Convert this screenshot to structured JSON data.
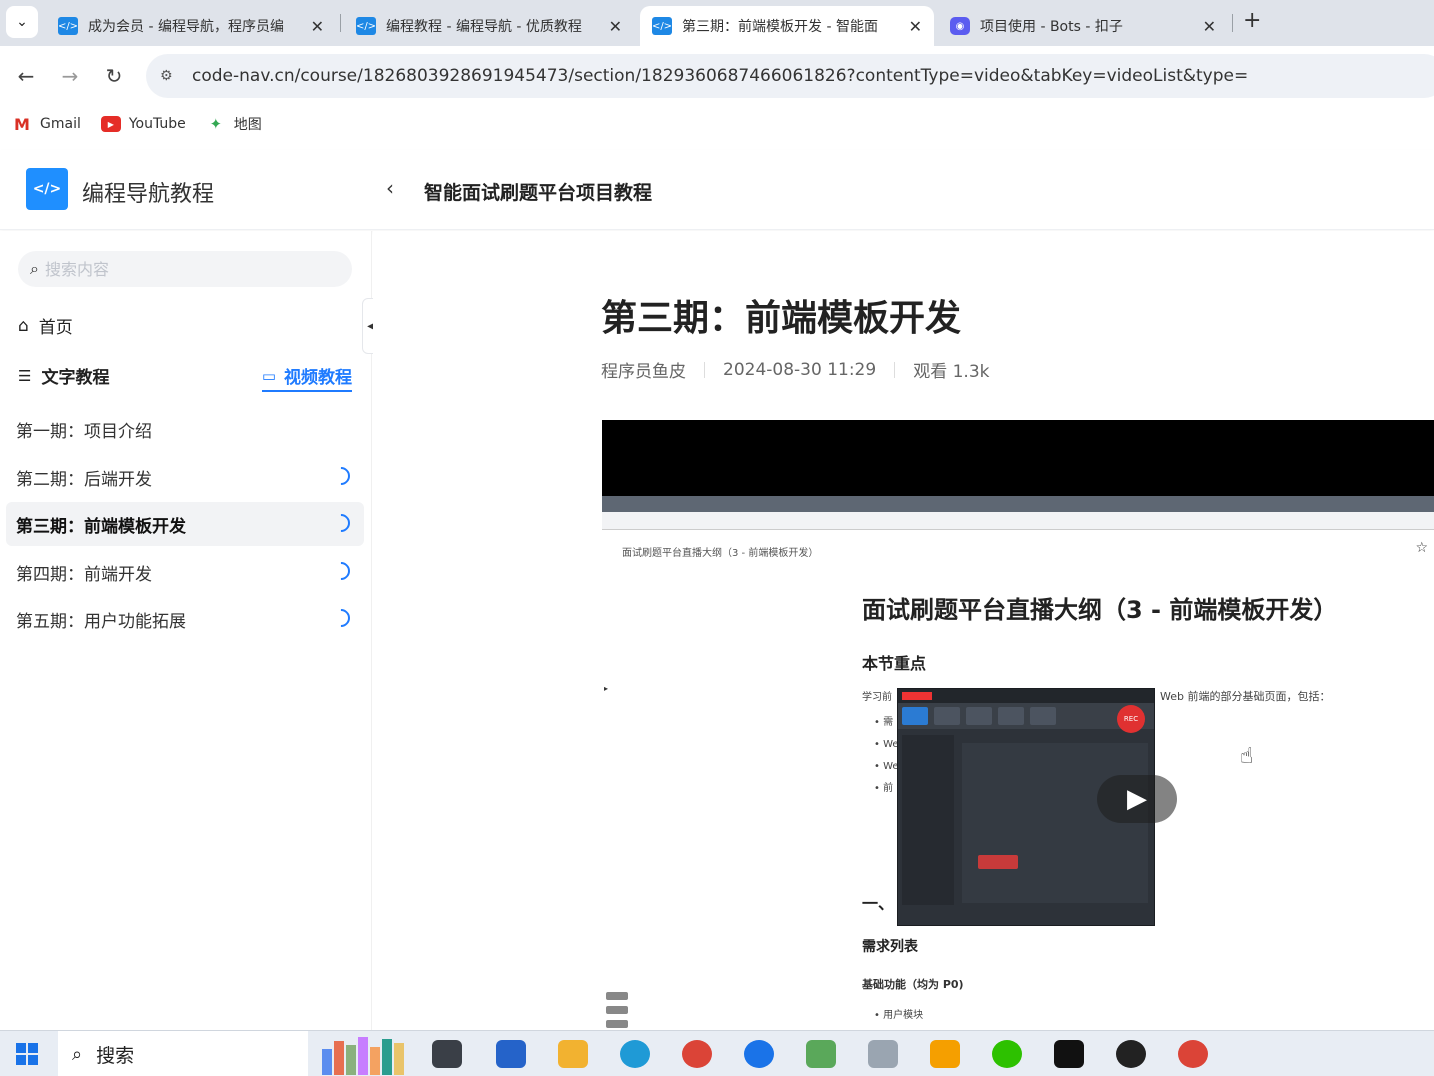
{
  "browser": {
    "tabs": [
      {
        "title": "成为会员 - 编程导航，程序员编",
        "icon": "code-nav-favicon"
      },
      {
        "title": "编程教程 - 编程导航 - 优质教程",
        "icon": "code-nav-favicon"
      },
      {
        "title": "第三期：前端模板开发 - 智能面",
        "icon": "code-nav-favicon"
      },
      {
        "title": "项目使用 - Bots - 扣子",
        "icon": "bots-favicon"
      }
    ],
    "close_glyph": "✕",
    "new_tab_glyph": "+",
    "url": "code-nav.cn/course/1826803928691945473/section/1829360687466061826?contentType=video&tabKey=videoList&type=",
    "bookmarks": [
      {
        "label": "Gmail",
        "icon": "gmail-icon"
      },
      {
        "label": "YouTube",
        "icon": "youtube-icon"
      },
      {
        "label": "地图",
        "icon": "maps-icon"
      }
    ]
  },
  "site": {
    "name": "编程导航教程",
    "course_title": "智能面试刷题平台项目教程"
  },
  "sidebar": {
    "search_placeholder": "搜索内容",
    "home_label": "首页",
    "text_tab": "文字教程",
    "video_tab": "视频教程",
    "lessons": [
      {
        "label": "第一期：项目介绍",
        "status": "none"
      },
      {
        "label": "第二期：后端开发",
        "status": "progress"
      },
      {
        "label": "第三期：前端模板开发",
        "status": "progress"
      },
      {
        "label": "第四期：前端开发",
        "status": "progress"
      },
      {
        "label": "第五期：用户功能拓展",
        "status": "progress"
      }
    ],
    "active_lesson": 2
  },
  "main": {
    "title": "第三期：前端模板开发",
    "author": "程序员鱼皮",
    "date": "2024-08-30 11:29",
    "views": "观看 1.3k"
  },
  "video_frame": {
    "doc_breadcrumb": "面试刷题平台直播大纲（3 - 前端模板开发）",
    "doc_title": "面试刷题平台直播大纲（3 - 前端模板开发）",
    "section_focus": "本节重点",
    "intro_left": "学习前",
    "intro_right": "Web 前端的部分基础页面，包括：",
    "bullets": [
      "需",
      "We",
      "We",
      "前"
    ],
    "section_one": "一、",
    "req_list": "需求列表",
    "basic_features": "基础功能（均为 P0)",
    "user_module": "用户模块",
    "rec_label": "REC"
  },
  "taskbar": {
    "search_label": "搜索",
    "apps": [
      {
        "name": "task-view",
        "color": "#3a3f47"
      },
      {
        "name": "microsoft-store",
        "color": "#2563c9"
      },
      {
        "name": "file-explorer",
        "color": "#f2b230"
      },
      {
        "name": "edge",
        "color": "#1f9ad6"
      },
      {
        "name": "chrome",
        "color": "#db4437"
      },
      {
        "name": "lenovo-app",
        "color": "#1a73e8"
      },
      {
        "name": "image-viewer",
        "color": "#5aa85a"
      },
      {
        "name": "document-app",
        "color": "#9aa5b1"
      },
      {
        "name": "fire-app",
        "color": "#f59f00"
      },
      {
        "name": "wechat",
        "color": "#2dc100"
      },
      {
        "name": "pycharm",
        "color": "#111111"
      },
      {
        "name": "qq",
        "color": "#222222"
      },
      {
        "name": "chrome-2",
        "color": "#db4437"
      }
    ]
  }
}
